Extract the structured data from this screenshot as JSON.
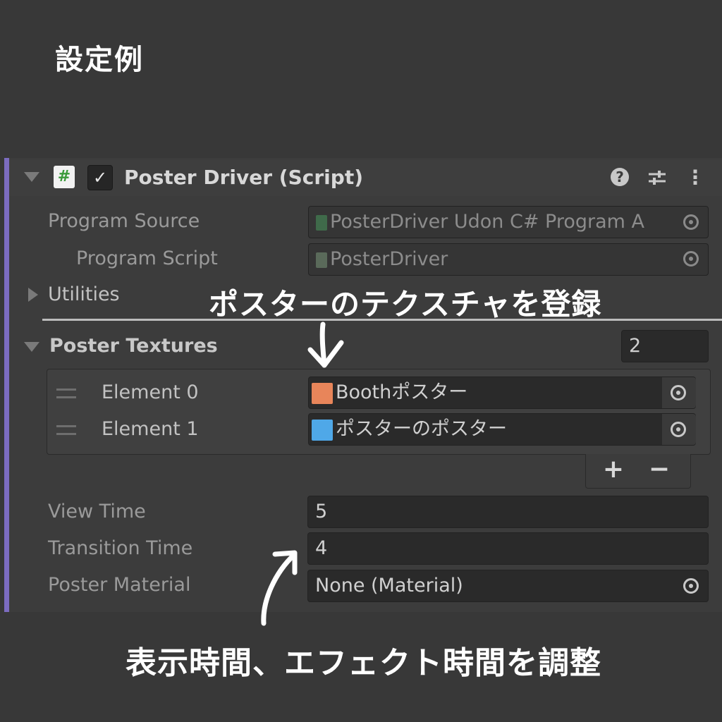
{
  "page_title": "設定例",
  "component": {
    "title": "Poster Driver (Script)",
    "enabled": "✓",
    "script_icon": "#"
  },
  "fields": {
    "program_source": {
      "label": "Program Source",
      "value": "PosterDriver Udon C# Program A"
    },
    "program_script": {
      "label": "Program Script",
      "value": "PosterDriver"
    },
    "utilities": {
      "label": "Utilities"
    },
    "poster_textures": {
      "label": "Poster Textures",
      "size": "2",
      "elements": [
        {
          "label": "Element 0",
          "value": "Boothポスター",
          "thumb_color": "#e8855a"
        },
        {
          "label": "Element 1",
          "value": "ポスターのポスター",
          "thumb_color": "#4fa8e8"
        }
      ],
      "add_label": "+",
      "remove_label": "−"
    },
    "view_time": {
      "label": "View Time",
      "value": "5"
    },
    "transition_time": {
      "label": "Transition Time",
      "value": "4"
    },
    "poster_material": {
      "label": "Poster Material",
      "value": "None (Material)"
    }
  },
  "annotations": {
    "top": "ポスターのテクスチャを登録",
    "bottom": "表示時間、エフェクト時間を調整"
  },
  "colors": {
    "accent": "#7c6cc0",
    "background": "#383838",
    "panel": "#3c3c3c"
  }
}
